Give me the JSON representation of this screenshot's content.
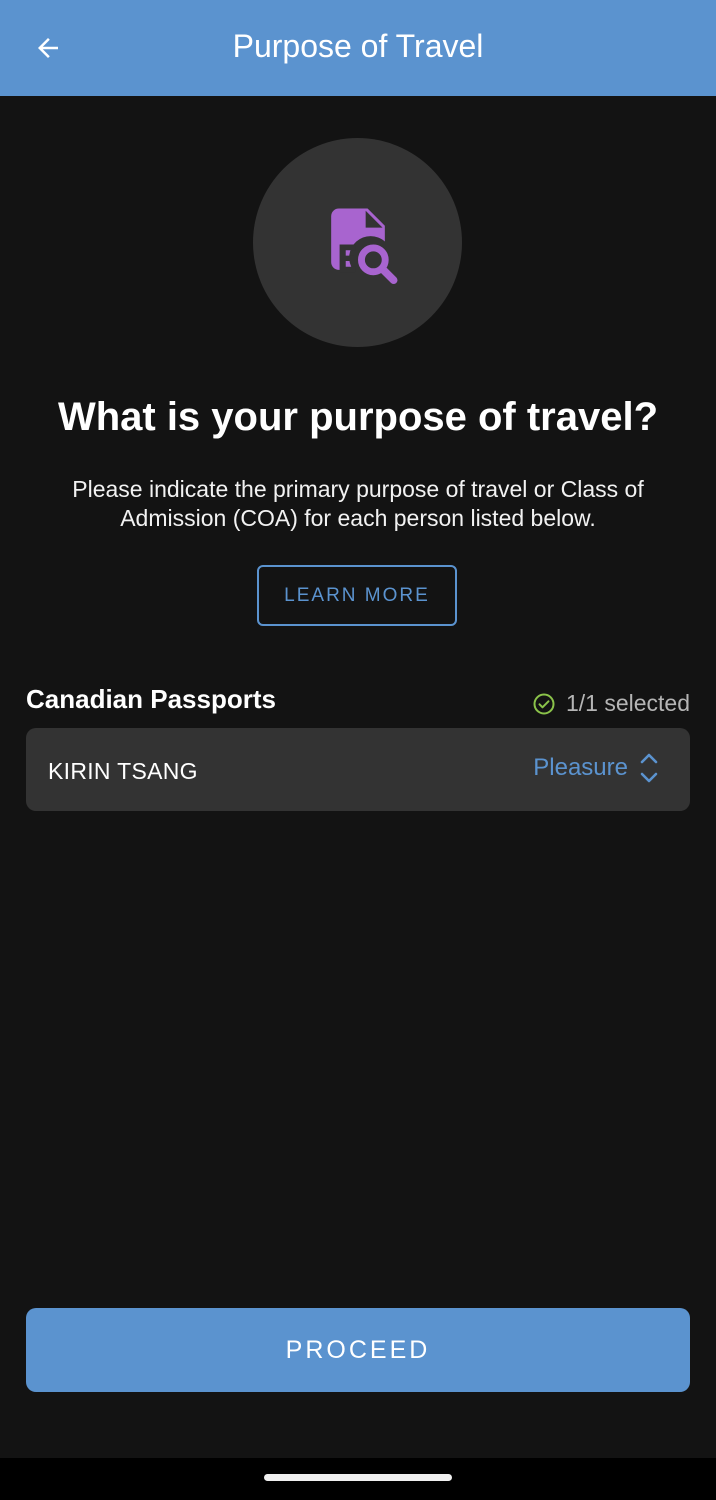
{
  "app_bar": {
    "title": "Purpose of Travel",
    "back_icon": "arrow-left-icon",
    "color": "#5b93cf"
  },
  "hero": {
    "icon": "document-search-icon",
    "icon_color": "#a864cf"
  },
  "content": {
    "heading": "What is your purpose of travel?",
    "description": "Please indicate the primary purpose of travel or Class of Admission (COA) for each person listed below.",
    "learn_more_label": "LEARN MORE"
  },
  "section": {
    "title": "Canadian Passports",
    "selected_text": "1/1 selected",
    "check_color": "#8bc34a"
  },
  "travelers": [
    {
      "name": "KIRIN TSANG",
      "purpose": "Pleasure"
    }
  ],
  "footer": {
    "proceed_label": "PROCEED"
  }
}
